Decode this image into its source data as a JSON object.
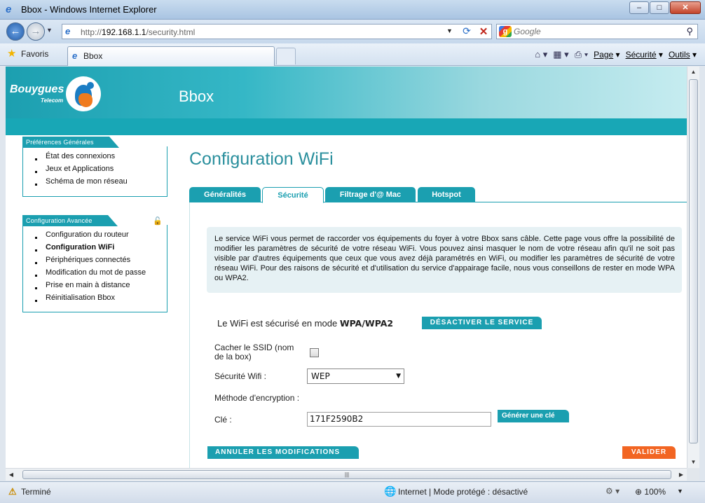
{
  "window": {
    "title": "Bbox - Windows Internet Explorer",
    "minimize": "–",
    "maximize": "□",
    "close": "✕"
  },
  "address": {
    "url_prefix": "http://",
    "url_host": "192.168.1.1",
    "url_path": "/security.html",
    "search_placeholder": "Google"
  },
  "favbar": {
    "favorites_label": "Favoris",
    "tab_label": "Bbox",
    "page_menu": "Page",
    "security_menu": "Sécurité",
    "tools_menu": "Outils"
  },
  "statusbar": {
    "status": "Terminé",
    "zone": "Internet | Mode protégé : désactivé",
    "zoom": "100%"
  },
  "header": {
    "brand_line1": "Bouygues",
    "brand_line2": "Telecom",
    "title": "Bbox"
  },
  "sidebar": {
    "general": {
      "heading": "Préférences Générales",
      "items": [
        {
          "label": "État des connexions"
        },
        {
          "label": "Jeux et Applications"
        },
        {
          "label": "Schéma de mon réseau"
        }
      ]
    },
    "advanced": {
      "heading": "Configuration Avancée",
      "items": [
        {
          "label": "Configuration du routeur"
        },
        {
          "label": "Configuration WiFi"
        },
        {
          "label": "Périphériques connectés"
        },
        {
          "label": "Modification du mot de passe"
        },
        {
          "label": "Prise en main à distance"
        },
        {
          "label": "Réinitialisation Bbox"
        }
      ]
    }
  },
  "main": {
    "title": "Configuration WiFi",
    "tabs": [
      {
        "label": "Généralités"
      },
      {
        "label": "Sécurité"
      },
      {
        "label": "Filtrage d'@ Mac"
      },
      {
        "label": "Hotspot"
      }
    ],
    "info_text": "Le service WiFi vous permet de raccorder vos équipements du foyer à votre Bbox sans câble. Cette page vous offre la possibilité de modifier les paramètres de sécurité de votre réseau WiFi. Vous pouvez ainsi masquer le nom de votre réseau afin qu'il ne soit pas visible par d'autres équipements que ceux que vous avez déjà paramétrés en WiFi, ou modifier les paramètres de sécurité de votre réseau WiFi. Pour des raisons de sécurité et d'utilisation du service d'appairage facile, nous vous conseillons de rester en mode WPA ou WPA2.",
    "mode_prefix": "Le WiFi est sécurisé en mode",
    "mode_value": "WPA/WPA2",
    "deactivate_button": "DÉSACTIVER LE SERVICE",
    "form": {
      "ssid_label_line1": "Cacher le SSID (nom",
      "ssid_label_line2": "de la box)",
      "ssid_checked": false,
      "security_label": "Sécurité Wifi :",
      "security_value": "WEP",
      "encryption_label": "Méthode d'encryption :",
      "key_label": "Clé :",
      "key_value": "171F2590B2",
      "generate_button": "Générer une clé"
    },
    "cancel_button": "ANNULER LES MODIFICATIONS",
    "validate_button": "VALIDER"
  }
}
